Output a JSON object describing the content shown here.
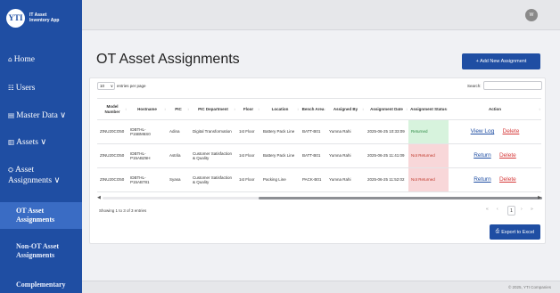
{
  "app": {
    "logo_text": "YTI",
    "title_line1": "IT Asset",
    "title_line2": "Inventory App"
  },
  "sidebar": {
    "items": [
      {
        "icon": "⌂",
        "label": "Home"
      },
      {
        "icon": "☷",
        "label": "Users"
      },
      {
        "icon": "▤",
        "label": "Master Data ∨"
      },
      {
        "icon": "▥",
        "label": "Assets ∨"
      },
      {
        "icon": "⛭",
        "label1": "Asset",
        "label2": "Assignments ∨"
      }
    ],
    "subitems": [
      {
        "label1": "OT Asset",
        "label2": "Assignments"
      },
      {
        "label1": "Non-OT Asset",
        "label2": "Assignments"
      },
      {
        "label1": "Complementary"
      }
    ]
  },
  "topbar": {
    "avatar_initials": "W"
  },
  "page": {
    "title": "OT Asset Assignments",
    "add_button": "+ Add New Assignment"
  },
  "table_controls": {
    "length_value": "10",
    "length_label": "entries per page",
    "search_label": "Search:"
  },
  "table": {
    "headers": [
      "Model Number",
      "Hostname",
      "PIC",
      "PIC Department",
      "Floor",
      "Location",
      "Bench Area",
      "Assigned By",
      "Assignment Date",
      "Assignment Status",
      "Action"
    ],
    "rows": [
      {
        "model": "ZINU20CO50",
        "hostname": "IDBTHL-P15BM6S0",
        "pic": "Adina",
        "dept": "Digital Transformation",
        "floor": "1st Floor",
        "location": "Battery Pack Line",
        "bench": "BATT-B01",
        "assigned_by": "Yumna Rahi",
        "date": "2025-06-25 10:33:09",
        "status": "Returned",
        "action1": "View Log",
        "action2": "Delete"
      },
      {
        "model": "ZINU20CO50",
        "hostname": "IDBTHL-P15ABZ6H",
        "pic": "Astrila",
        "dept": "Customer Satisfaction & Quality",
        "floor": "1st Floor",
        "location": "Battery Pack Line",
        "bench": "BATT-B01",
        "assigned_by": "Yumna Rahi",
        "date": "2025-06-25 11:41:09",
        "status": "Not Returned",
        "action1": "Return",
        "action2": "Delete"
      },
      {
        "model": "ZINU20CO50",
        "hostname": "IDBTHL-P15AB781",
        "pic": "Syasa",
        "dept": "Customer Satisfaction & Quality",
        "floor": "1st Floor",
        "location": "Packing Line",
        "bench": "PACK-B01",
        "assigned_by": "Yumna Rahi",
        "date": "2025-06-25 11:52:02",
        "status": "Not Returned",
        "action1": "Return",
        "action2": "Delete"
      }
    ]
  },
  "pagination": {
    "info": "Showing 1 to 3 of 3 entries",
    "prev2": "«",
    "prev1": "‹",
    "current": "1",
    "next1": "›",
    "next2": "»"
  },
  "export_button": "Export to Excel",
  "footer": {
    "text": "© 2025, YTI Companies"
  },
  "colors": {
    "primary": "#1f4ea3",
    "returned_bg": "#d7f3dd",
    "not_returned_bg": "#f8d7d9",
    "delete": "#d63a3a"
  }
}
